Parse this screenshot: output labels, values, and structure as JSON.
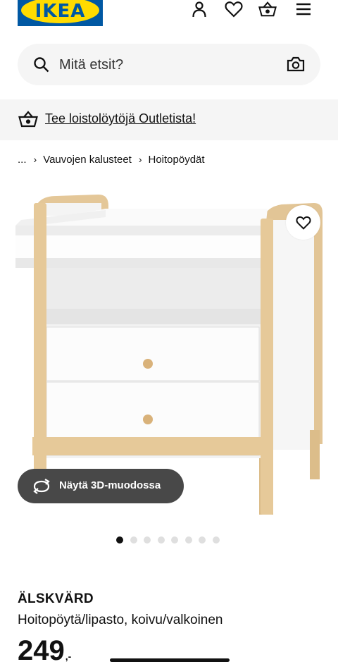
{
  "header": {
    "logo_text": "IKEA",
    "icons": {
      "account": "person-icon",
      "wishlist": "heart-icon",
      "cart": "shopping-basket-icon",
      "menu": "hamburger-menu-icon"
    }
  },
  "search": {
    "placeholder": "Mitä etsit?",
    "icon": "search-icon",
    "camera_icon": "camera-icon"
  },
  "promo": {
    "icon": "shopping-basket-icon",
    "text": "Tee loistolöytöjä Outletista!"
  },
  "breadcrumb": {
    "ellipsis": "...",
    "items": [
      "Vauvojen kalusteet",
      "Hoitopöydät"
    ]
  },
  "gallery": {
    "view_3d_label": "Näytä 3D-muodossa",
    "image_count": 8,
    "active_index": 0
  },
  "product": {
    "name": "ÄLSKVÄRD",
    "description": "Hoitopöytä/lipasto, koivu/valkoinen",
    "price_integer": "249",
    "price_suffix": ",-"
  },
  "colors": {
    "brand_blue": "#0058a3",
    "brand_yellow": "#ffdb00",
    "text": "#111111",
    "surface": "#f5f5f5",
    "button_dark": "#484848"
  }
}
